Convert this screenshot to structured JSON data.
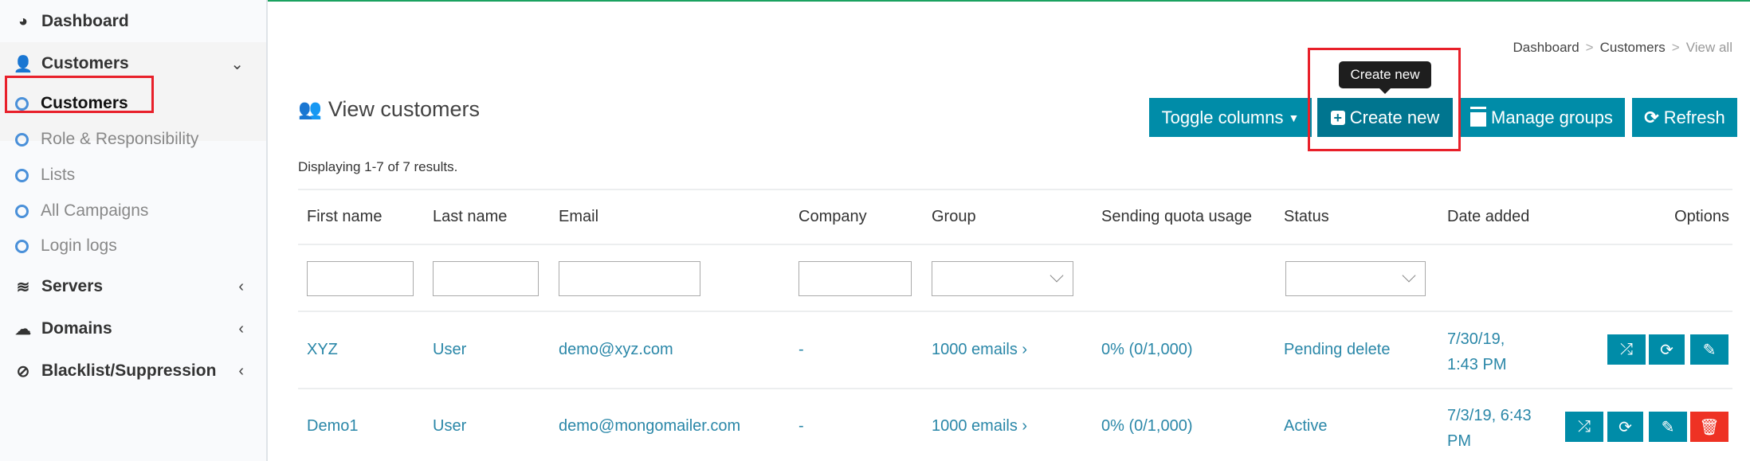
{
  "sidebar": {
    "items": [
      {
        "label": "Dashboard",
        "icon": "dashboard-icon"
      },
      {
        "label": "Customers",
        "icon": "user-icon",
        "expanded": true
      },
      {
        "label": "Servers",
        "icon": "database-icon"
      },
      {
        "label": "Domains",
        "icon": "cloud-icon"
      },
      {
        "label": "Blacklist/Suppression",
        "icon": "ban-icon"
      }
    ],
    "sub_items": [
      {
        "label": "Customers",
        "active": true
      },
      {
        "label": "Role & Responsibility"
      },
      {
        "label": "Lists"
      },
      {
        "label": "All Campaigns"
      },
      {
        "label": "Login logs"
      }
    ]
  },
  "breadcrumb": [
    "Dashboard",
    "Customers",
    "View all"
  ],
  "page_title": "View customers",
  "toolbar": {
    "toggle_columns": "Toggle columns",
    "create_new": "Create new",
    "manage_groups": "Manage groups",
    "refresh": "Refresh",
    "tooltip": "Create new"
  },
  "summary": "Displaying 1-7 of 7 results.",
  "table": {
    "headers": [
      "First name",
      "Last name",
      "Email",
      "Company",
      "Group",
      "Sending quota usage",
      "Status",
      "Date added",
      "Options"
    ],
    "rows": [
      {
        "first": "XYZ",
        "last": "User",
        "email": "demo@xyz.com",
        "company": "-",
        "group": "1000 emails ›",
        "quota": "0% (0/1,000)",
        "status": "Pending delete",
        "date1": "7/30/19,",
        "date2": "1:43 PM"
      },
      {
        "first": "Demo1",
        "last": "User",
        "email": "demo@mongomailer.com",
        "company": "-",
        "group": "1000 emails ›",
        "quota": "0% (0/1,000)",
        "status": "Active",
        "date1": "7/3/19, 6:43",
        "date2": "PM"
      }
    ]
  },
  "colors": {
    "primary": "#008ca8",
    "primary_dark": "#00758f",
    "danger": "#ee3224",
    "link": "#2a87a8",
    "highlight": "#e8202a"
  }
}
